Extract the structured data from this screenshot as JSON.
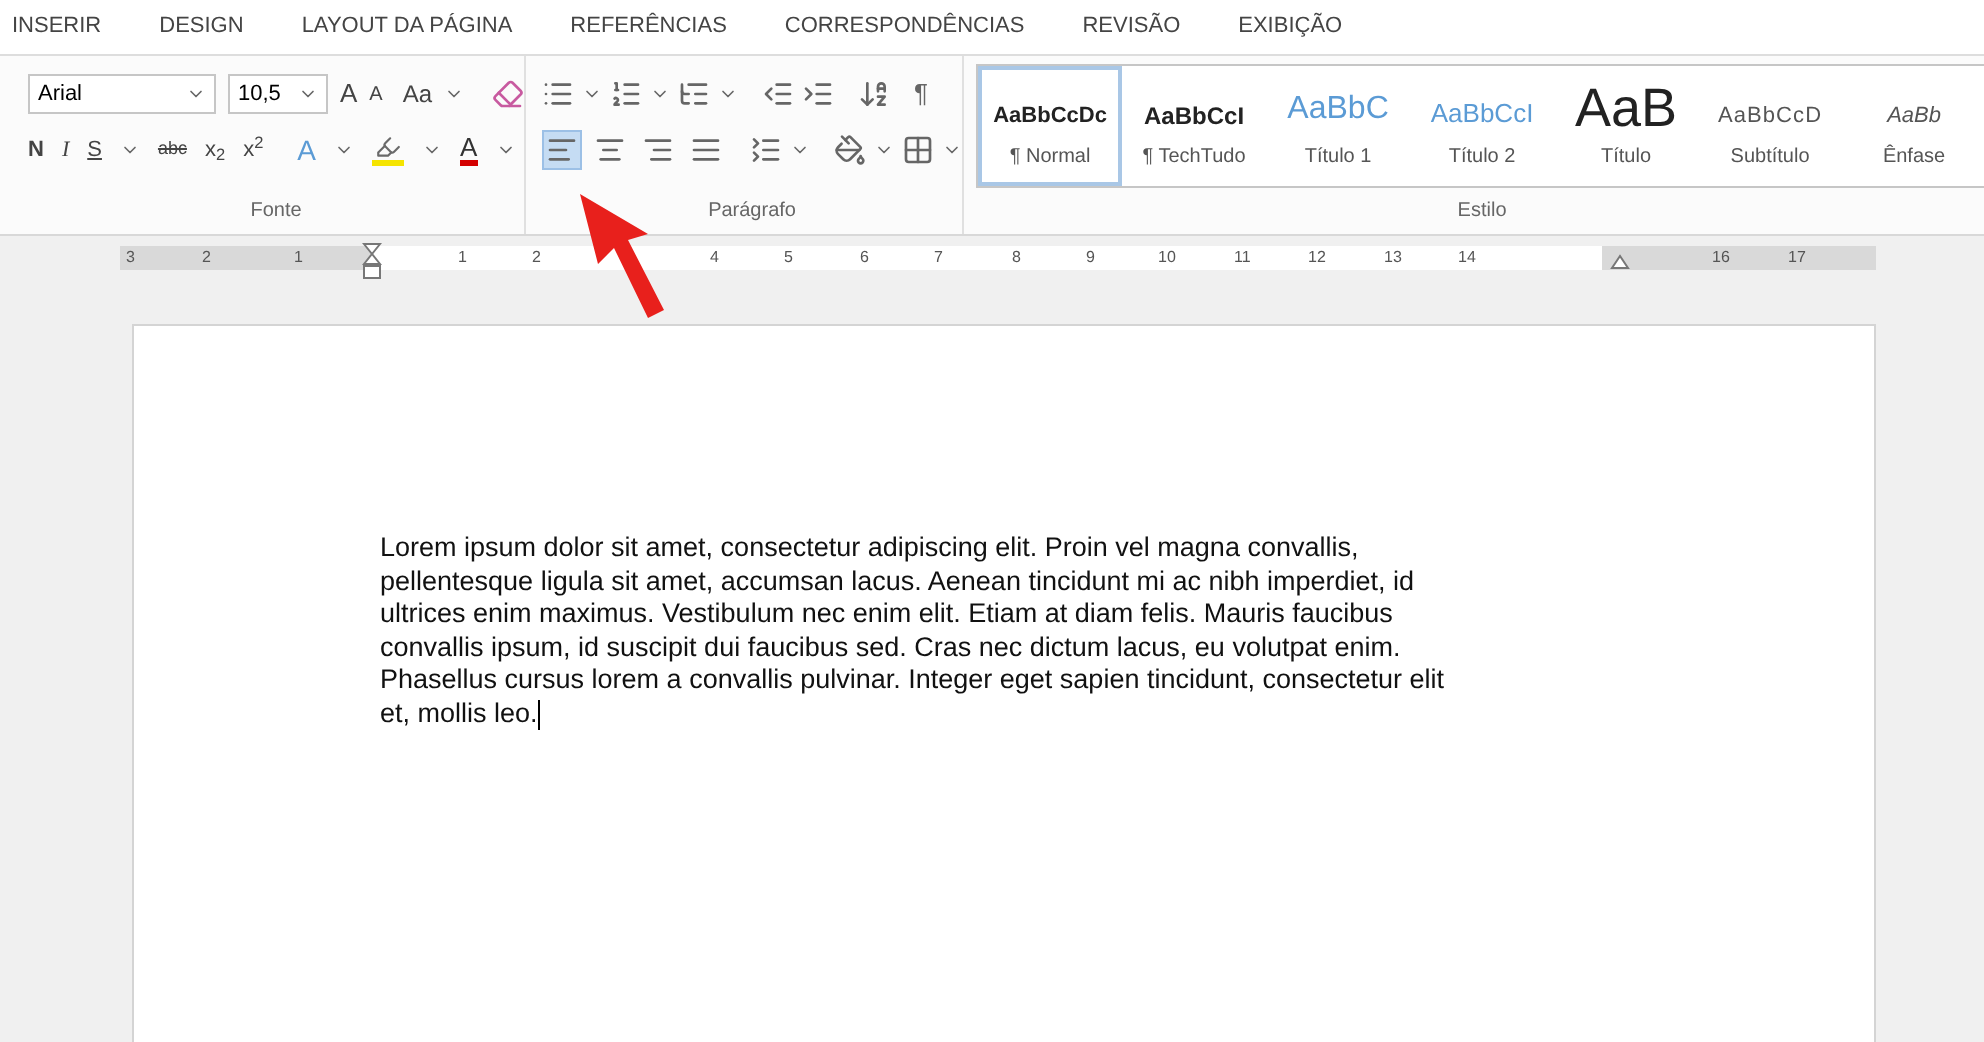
{
  "tabs": [
    {
      "label": "INSERIR"
    },
    {
      "label": "DESIGN"
    },
    {
      "label": "LAYOUT DA PÁGINA"
    },
    {
      "label": "REFERÊNCIAS"
    },
    {
      "label": "CORRESPONDÊNCIAS"
    },
    {
      "label": "REVISÃO"
    },
    {
      "label": "EXIBIÇÃO"
    }
  ],
  "font_group": {
    "label": "Fonte",
    "font": "Arial",
    "size": "10,5",
    "grow": "A",
    "shrink": "A",
    "change_case": "Aa",
    "bold": "N",
    "italic": "I",
    "underline": "S",
    "strikethrough": "abc",
    "subscript": "x$_{2}$",
    "superscript": "x$^{2}$",
    "text_effects": "A",
    "font_color": "A"
  },
  "paragraph_group": {
    "label": "Parágrafo",
    "pilcrow": "¶",
    "alignments": [
      {
        "kind": "left",
        "selected": true
      },
      {
        "kind": "center",
        "selected": false
      },
      {
        "kind": "right",
        "selected": false
      },
      {
        "kind": "justify",
        "selected": false
      }
    ]
  },
  "styles_group": {
    "label": "Estilo",
    "styles": [
      {
        "kind": "normal",
        "preview": "AaBbCcDc",
        "name": "¶ Normal",
        "selected": true
      },
      {
        "kind": "strong",
        "preview": "AaBbCcI",
        "name": "¶ TechTudo",
        "selected": false
      },
      {
        "kind": "heading1",
        "preview": "AaBbC",
        "name": "Título 1",
        "selected": false
      },
      {
        "kind": "heading2",
        "preview": "AaBbCcI",
        "name": "Título 2",
        "selected": false
      },
      {
        "kind": "title",
        "preview": "AaB",
        "name": "Título",
        "selected": false
      },
      {
        "kind": "subtitle",
        "preview": "AaBbCcD",
        "name": "Subtítulo",
        "selected": false
      },
      {
        "kind": "emphasis",
        "preview": "AaBb",
        "name": "Ênfase",
        "selected": false
      }
    ]
  },
  "ruler": {
    "labels": [
      "3",
      "2",
      "1",
      "1",
      "2",
      "4",
      "5",
      "6",
      "7",
      "8",
      "9",
      "10",
      "11",
      "12",
      "13",
      "14",
      "16",
      "17"
    ]
  },
  "document": {
    "lines": [
      "Lorem ipsum dolor sit amet, consectetur adipiscing elit. Proin vel magna convallis,",
      "pellentesque ligula sit amet, accumsan lacus. Aenean tincidunt mi ac nibh imperdiet, id",
      "ultrices enim maximus. Vestibulum nec enim elit. Etiam at diam felis. Mauris faucibus",
      "convallis ipsum, id suscipit dui faucibus sed. Cras nec dictum lacus, eu volutpat enim.",
      "Phasellus cursus lorem a convallis pulvinar. Integer eget sapien tincidunt, consectetur elit",
      "et, mollis leo."
    ]
  }
}
